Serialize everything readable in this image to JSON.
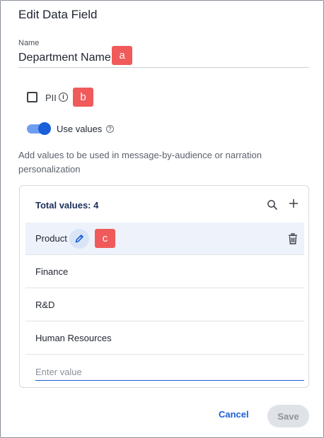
{
  "dialog": {
    "title": "Edit Data Field"
  },
  "name_field": {
    "label": "Name",
    "value": "Department Name"
  },
  "markers": {
    "a": "a",
    "b": "b",
    "c": "c",
    "color": "#f05a5a"
  },
  "pii": {
    "label": "PII",
    "checked": false,
    "icon": "info-icon"
  },
  "use_values": {
    "label": "Use values",
    "enabled": true,
    "icon": "help-icon"
  },
  "description": "Add values to be used in message-by-audience or narration personalization",
  "values_panel": {
    "total_label": "Total values: 4",
    "search_icon": "search-icon",
    "add_icon": "plus-icon",
    "rows": [
      {
        "label": "Product",
        "selected": true
      },
      {
        "label": "Finance",
        "selected": false
      },
      {
        "label": "R&D",
        "selected": false
      },
      {
        "label": "Human Resources",
        "selected": false
      }
    ],
    "new_value_placeholder": "Enter value"
  },
  "footer": {
    "cancel_label": "Cancel",
    "save_label": "Save"
  },
  "colors": {
    "accent": "#1a5ed8",
    "selected_row": "#edf2fb",
    "disabled_button": "#dfe2e7"
  }
}
